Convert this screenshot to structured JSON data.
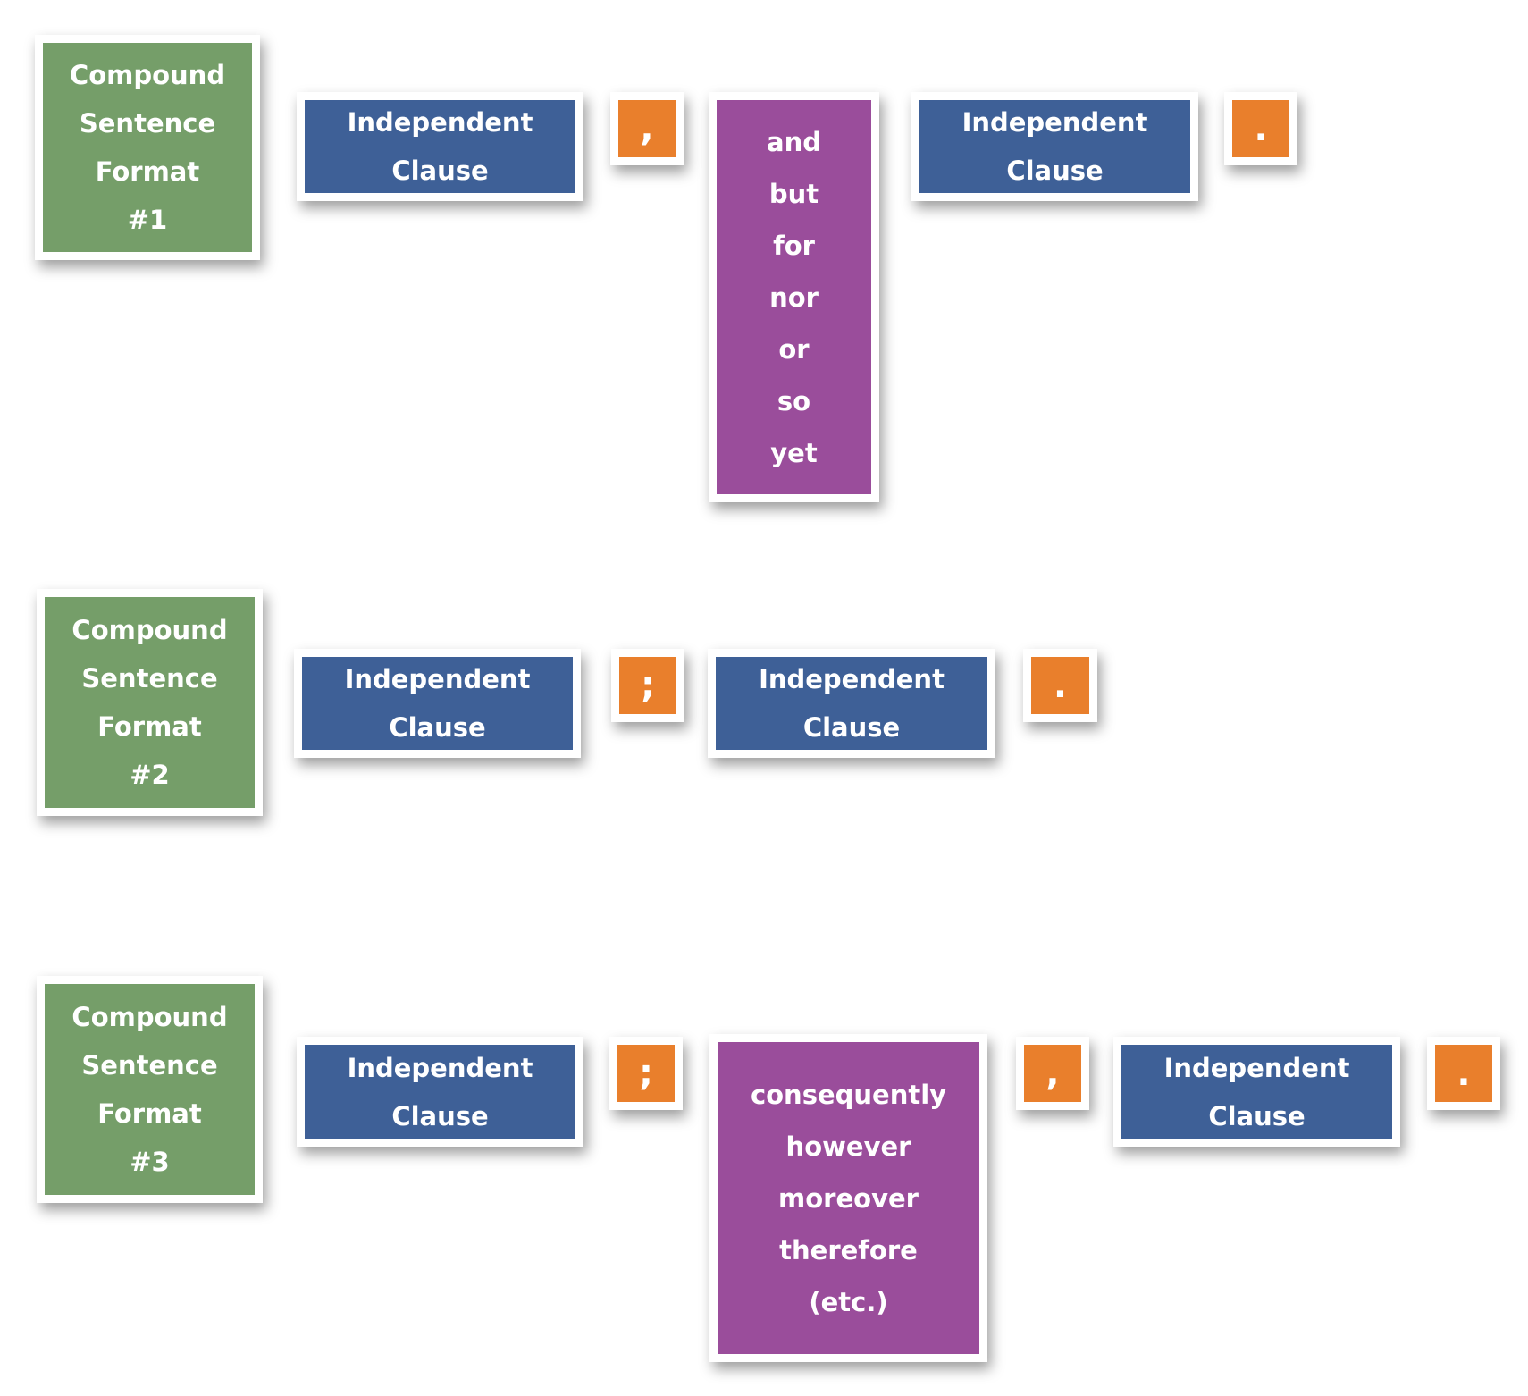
{
  "formats": [
    {
      "title_lines": [
        "Compound",
        "Sentence",
        "Format",
        "#1"
      ],
      "elements": [
        {
          "type": "clause",
          "lines": [
            "Independent",
            "Clause"
          ]
        },
        {
          "type": "punct",
          "symbol": ","
        },
        {
          "type": "connector",
          "lines": [
            "and",
            "but",
            "for",
            "nor",
            "or",
            "so",
            "yet"
          ]
        },
        {
          "type": "clause",
          "lines": [
            "Independent",
            "Clause"
          ]
        },
        {
          "type": "punct",
          "symbol": "."
        }
      ]
    },
    {
      "title_lines": [
        "Compound",
        "Sentence",
        "Format",
        "#2"
      ],
      "elements": [
        {
          "type": "clause",
          "lines": [
            "Independent",
            "Clause"
          ]
        },
        {
          "type": "punct",
          "symbol": ";"
        },
        {
          "type": "clause",
          "lines": [
            "Independent",
            "Clause"
          ]
        },
        {
          "type": "punct",
          "symbol": "."
        }
      ]
    },
    {
      "title_lines": [
        "Compound",
        "Sentence",
        "Format",
        "#3"
      ],
      "elements": [
        {
          "type": "clause",
          "lines": [
            "Independent",
            "Clause"
          ]
        },
        {
          "type": "punct",
          "symbol": ";"
        },
        {
          "type": "connector",
          "lines": [
            "consequently",
            "however",
            "moreover",
            "therefore",
            "(etc.)"
          ]
        },
        {
          "type": "punct",
          "symbol": ","
        },
        {
          "type": "clause",
          "lines": [
            "Independent",
            "Clause"
          ]
        },
        {
          "type": "punct",
          "symbol": "."
        }
      ]
    }
  ],
  "colors": {
    "title_box": "#759e69",
    "clause_box": "#3e6097",
    "connector_box": "#9a4d9b",
    "punctuation_box": "#e97f2c"
  }
}
